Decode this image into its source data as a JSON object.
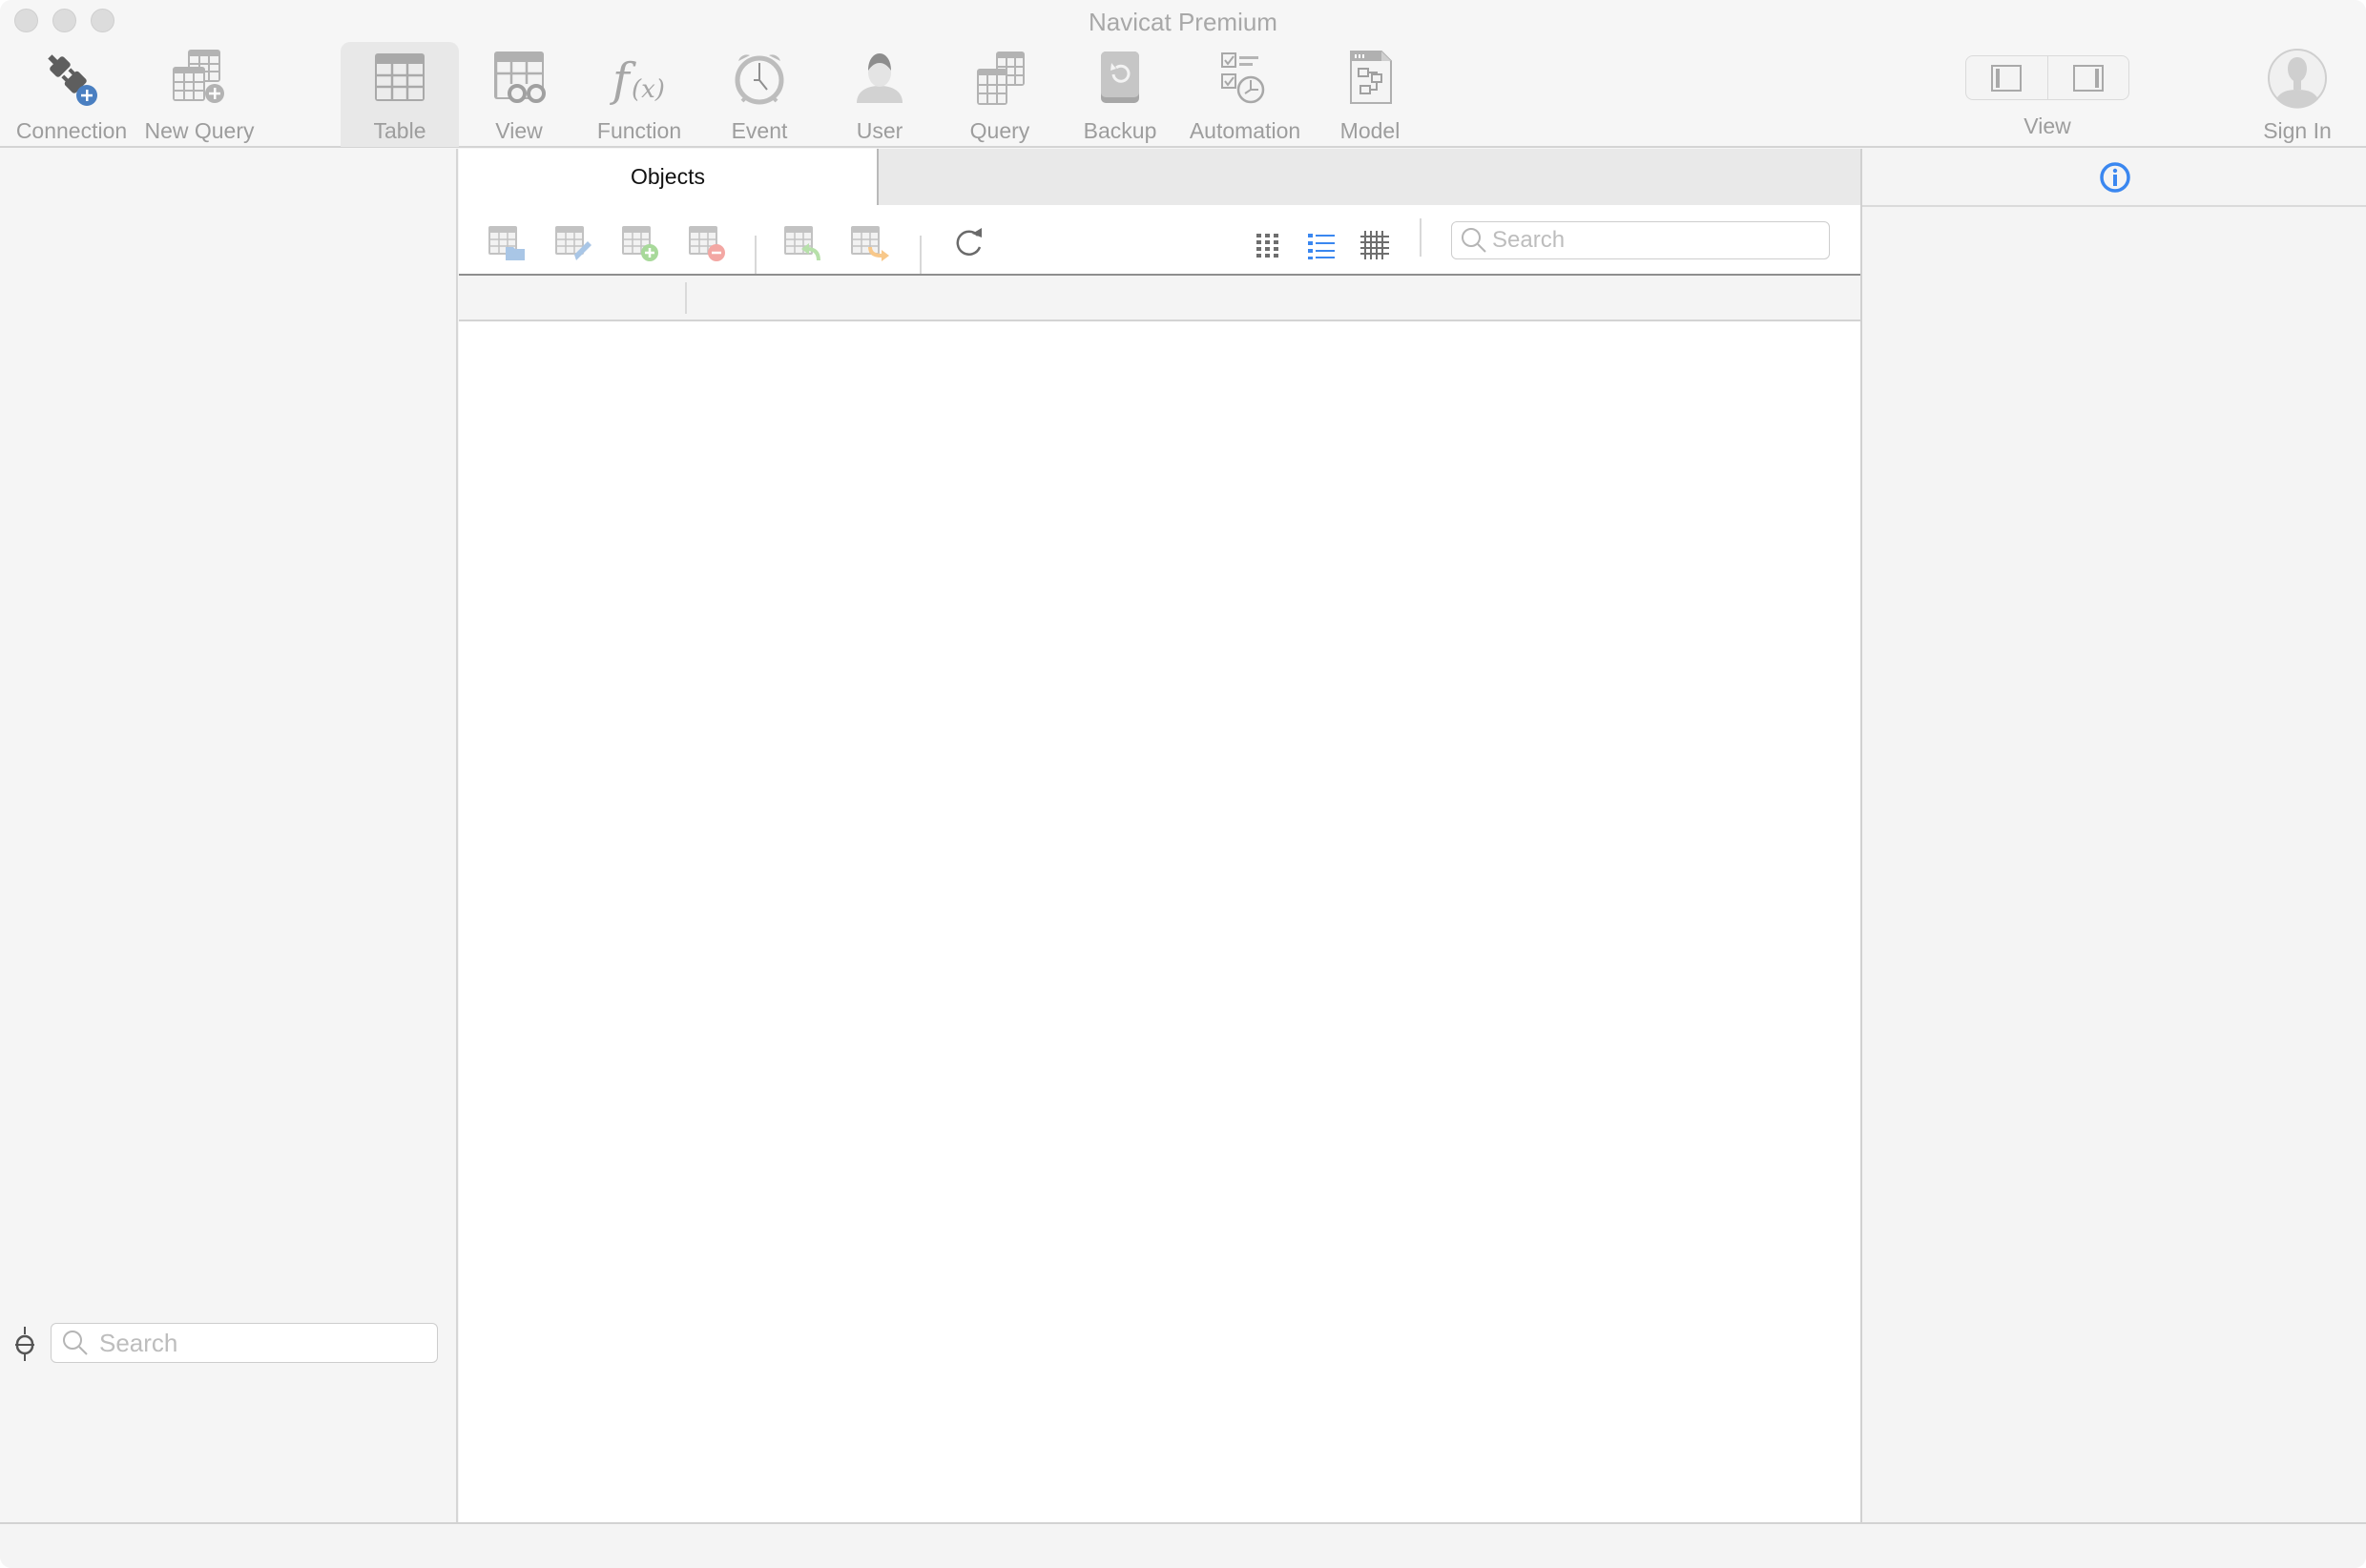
{
  "window": {
    "title": "Navicat Premium"
  },
  "toolbar": {
    "items": [
      {
        "id": "connection",
        "label": "Connection",
        "icon": "plug-add-icon"
      },
      {
        "id": "new-query",
        "label": "New Query",
        "icon": "new-query-icon"
      },
      {
        "id": "table",
        "label": "Table",
        "icon": "table-icon",
        "active": true
      },
      {
        "id": "view",
        "label": "View",
        "icon": "view-glasses-icon"
      },
      {
        "id": "function",
        "label": "Function",
        "icon": "function-icon"
      },
      {
        "id": "event",
        "label": "Event",
        "icon": "alarm-clock-icon"
      },
      {
        "id": "user",
        "label": "User",
        "icon": "user-icon"
      },
      {
        "id": "query",
        "label": "Query",
        "icon": "query-icon"
      },
      {
        "id": "backup",
        "label": "Backup",
        "icon": "backup-icon"
      },
      {
        "id": "automation",
        "label": "Automation",
        "icon": "automation-icon"
      },
      {
        "id": "model",
        "label": "Model",
        "icon": "model-icon"
      }
    ],
    "view_label": "View",
    "sign_in_label": "Sign In"
  },
  "sidebar": {
    "search_placeholder": "Search"
  },
  "main": {
    "tabs": [
      {
        "label": "Objects",
        "active": true
      }
    ],
    "object_tools": [
      {
        "name": "open-table",
        "icon": "table-open-icon"
      },
      {
        "name": "design-table",
        "icon": "table-design-icon"
      },
      {
        "name": "new-table",
        "icon": "table-add-icon"
      },
      {
        "name": "delete-table",
        "icon": "table-delete-icon"
      },
      {
        "name": "import-wizard",
        "icon": "table-import-icon"
      },
      {
        "name": "export-wizard",
        "icon": "table-export-icon"
      },
      {
        "name": "refresh",
        "icon": "refresh-icon"
      }
    ],
    "view_modes": [
      {
        "name": "grid-view",
        "icon": "grid-icon",
        "active": false
      },
      {
        "name": "list-view",
        "icon": "list-icon",
        "active": true
      },
      {
        "name": "detail-view",
        "icon": "detail-grid-icon",
        "active": false
      }
    ],
    "search_placeholder": "Search",
    "columns": [
      "",
      ""
    ],
    "rows": []
  },
  "info_panel": {
    "icon": "info-icon"
  },
  "colors": {
    "accent": "#3a87f0",
    "connection_badge": "#4a7fc1",
    "add_green": "#a8d99a",
    "delete_red": "#f3a7a3",
    "import_green": "#b7e0aa",
    "export_orange": "#f8c88a",
    "open_blue": "#a9c6e6"
  }
}
